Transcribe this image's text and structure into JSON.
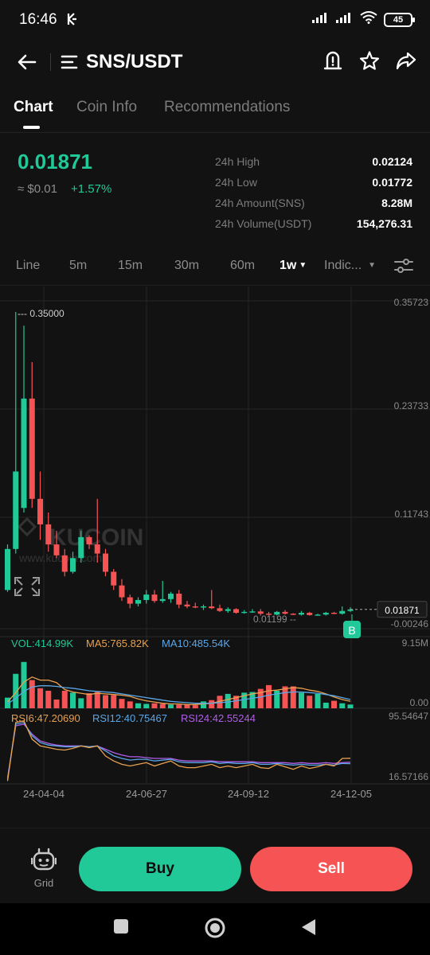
{
  "status": {
    "time": "16:46",
    "battery": "45"
  },
  "header": {
    "pair": "SNS/USDT"
  },
  "tabs": [
    {
      "label": "Chart",
      "active": true
    },
    {
      "label": "Coin Info",
      "active": false
    },
    {
      "label": "Recommendations",
      "active": false
    }
  ],
  "ticker": {
    "price": "0.01871",
    "fiat": "≈ $0.01",
    "change": "+1.57%",
    "stats": [
      {
        "label": "24h High",
        "value": "0.02124"
      },
      {
        "label": "24h Low",
        "value": "0.01772"
      },
      {
        "label": "24h Amount(SNS)",
        "value": "8.28M"
      },
      {
        "label": "24h Volume(USDT)",
        "value": "154,276.31"
      }
    ]
  },
  "toolbar": {
    "intervals": [
      "Line",
      "5m",
      "15m",
      "30m",
      "60m"
    ],
    "selected_interval": "1w",
    "indicators_label": "Indic..."
  },
  "chart_data": [
    {
      "type": "candlestick",
      "interval": "1w",
      "y_ticks": [
        "0.35723",
        "0.23733",
        "0.11743",
        "-0.00246"
      ],
      "ylim": [
        -0.00246,
        0.35723
      ],
      "annotations": {
        "high_marker": "0.35000",
        "low_marker": "0.01199",
        "last_price_tag": "0.01871",
        "trade_marker": "B"
      },
      "x_ticks": [
        "24-04-04",
        "24-06-27",
        "24-09-12",
        "24-12-05"
      ],
      "candles": [
        {
          "o": 0.04,
          "h": 0.09,
          "l": 0.038,
          "c": 0.085
        },
        {
          "o": 0.085,
          "h": 0.345,
          "l": 0.08,
          "c": 0.17
        },
        {
          "o": 0.13,
          "h": 0.33,
          "l": 0.125,
          "c": 0.25
        },
        {
          "o": 0.25,
          "h": 0.29,
          "l": 0.13,
          "c": 0.14
        },
        {
          "o": 0.14,
          "h": 0.17,
          "l": 0.095,
          "c": 0.112
        },
        {
          "o": 0.112,
          "h": 0.125,
          "l": 0.082,
          "c": 0.09
        },
        {
          "o": 0.09,
          "h": 0.105,
          "l": 0.075,
          "c": 0.078
        },
        {
          "o": 0.078,
          "h": 0.085,
          "l": 0.055,
          "c": 0.06
        },
        {
          "o": 0.06,
          "h": 0.082,
          "l": 0.058,
          "c": 0.075
        },
        {
          "o": 0.075,
          "h": 0.105,
          "l": 0.07,
          "c": 0.098
        },
        {
          "o": 0.098,
          "h": 0.1,
          "l": 0.085,
          "c": 0.09
        },
        {
          "o": 0.09,
          "h": 0.14,
          "l": 0.07,
          "c": 0.08
        },
        {
          "o": 0.08,
          "h": 0.085,
          "l": 0.055,
          "c": 0.06
        },
        {
          "o": 0.06,
          "h": 0.063,
          "l": 0.04,
          "c": 0.045
        },
        {
          "o": 0.045,
          "h": 0.052,
          "l": 0.028,
          "c": 0.032
        },
        {
          "o": 0.032,
          "h": 0.035,
          "l": 0.02,
          "c": 0.025
        },
        {
          "o": 0.025,
          "h": 0.032,
          "l": 0.022,
          "c": 0.029
        },
        {
          "o": 0.029,
          "h": 0.04,
          "l": 0.025,
          "c": 0.035
        },
        {
          "o": 0.035,
          "h": 0.04,
          "l": 0.026,
          "c": 0.028
        },
        {
          "o": 0.028,
          "h": 0.05,
          "l": 0.026,
          "c": 0.03
        },
        {
          "o": 0.03,
          "h": 0.038,
          "l": 0.026,
          "c": 0.036
        },
        {
          "o": 0.036,
          "h": 0.04,
          "l": 0.02,
          "c": 0.024
        },
        {
          "o": 0.024,
          "h": 0.028,
          "l": 0.02,
          "c": 0.022
        },
        {
          "o": 0.022,
          "h": 0.026,
          "l": 0.02,
          "c": 0.021
        },
        {
          "o": 0.021,
          "h": 0.024,
          "l": 0.018,
          "c": 0.022
        },
        {
          "o": 0.022,
          "h": 0.04,
          "l": 0.019,
          "c": 0.02
        },
        {
          "o": 0.02,
          "h": 0.024,
          "l": 0.016,
          "c": 0.017
        },
        {
          "o": 0.017,
          "h": 0.021,
          "l": 0.015,
          "c": 0.019
        },
        {
          "o": 0.019,
          "h": 0.02,
          "l": 0.014,
          "c": 0.015
        },
        {
          "o": 0.015,
          "h": 0.018,
          "l": 0.014,
          "c": 0.016
        },
        {
          "o": 0.016,
          "h": 0.019,
          "l": 0.015,
          "c": 0.0165
        },
        {
          "o": 0.0165,
          "h": 0.019,
          "l": 0.012,
          "c": 0.014
        },
        {
          "o": 0.014,
          "h": 0.016,
          "l": 0.012,
          "c": 0.013
        },
        {
          "o": 0.013,
          "h": 0.017,
          "l": 0.012,
          "c": 0.016
        },
        {
          "o": 0.016,
          "h": 0.018,
          "l": 0.013,
          "c": 0.014
        },
        {
          "o": 0.014,
          "h": 0.0145,
          "l": 0.0125,
          "c": 0.013
        },
        {
          "o": 0.013,
          "h": 0.017,
          "l": 0.012,
          "c": 0.015
        },
        {
          "o": 0.015,
          "h": 0.016,
          "l": 0.012,
          "c": 0.0125
        },
        {
          "o": 0.0125,
          "h": 0.014,
          "l": 0.012,
          "c": 0.013
        },
        {
          "o": 0.013,
          "h": 0.016,
          "l": 0.012,
          "c": 0.015
        },
        {
          "o": 0.015,
          "h": 0.016,
          "l": 0.0135,
          "c": 0.014
        },
        {
          "o": 0.014,
          "h": 0.022,
          "l": 0.013,
          "c": 0.017
        },
        {
          "o": 0.017,
          "h": 0.021,
          "l": 0.016,
          "c": 0.0187
        }
      ]
    },
    {
      "type": "bar",
      "name": "volume",
      "labels": {
        "vol": "VOL:414.99K",
        "ma5": "MA5:765.82K",
        "ma10": "MA10:485.54K"
      },
      "y_ticks": [
        "9.15M",
        "0.00"
      ],
      "ylim": [
        0,
        9.15
      ],
      "unit": "M",
      "values": [
        1.7,
        5.5,
        7.4,
        4.5,
        3.2,
        2.8,
        1.4,
        2.8,
        2.5,
        1.6,
        2.4,
        2.6,
        2.1,
        2.1,
        1.5,
        1.1,
        0.8,
        0.7,
        0.8,
        0.7,
        0.6,
        0.6,
        0.6,
        0.5,
        1.1,
        1.3,
        2.0,
        2.3,
        2.0,
        2.5,
        2.6,
        3.1,
        3.7,
        2.8,
        3.5,
        3.5,
        2.5,
        2.0,
        2.3,
        0.9,
        1.2,
        0.8,
        0.6
      ],
      "up": [
        true,
        true,
        true,
        false,
        false,
        false,
        false,
        false,
        true,
        true,
        false,
        false,
        false,
        false,
        false,
        false,
        true,
        true,
        false,
        false,
        true,
        false,
        false,
        false,
        true,
        false,
        false,
        true,
        false,
        true,
        true,
        false,
        false,
        true,
        false,
        false,
        true,
        false,
        true,
        true,
        false,
        true,
        true
      ],
      "ma5": [
        1.0,
        2.5,
        4.2,
        5.0,
        4.5,
        4.5,
        4.1,
        3.0,
        2.6,
        2.4,
        2.2,
        2.4,
        2.3,
        2.2,
        2.1,
        1.9,
        1.5,
        1.2,
        1.0,
        0.8,
        0.7,
        0.7,
        0.6,
        0.6,
        0.7,
        0.8,
        1.1,
        1.4,
        1.7,
        2.0,
        2.3,
        2.5,
        2.8,
        2.9,
        3.1,
        3.3,
        3.2,
        2.9,
        2.7,
        2.3,
        1.8,
        1.4,
        1.1
      ],
      "ma10": [
        0.7,
        1.6,
        2.7,
        3.4,
        3.6,
        3.6,
        3.5,
        3.3,
        3.2,
        3.0,
        2.8,
        2.7,
        2.6,
        2.5,
        2.3,
        2.1,
        1.9,
        1.7,
        1.5,
        1.3,
        1.1,
        1.0,
        0.9,
        0.8,
        0.8,
        0.8,
        0.9,
        1.0,
        1.2,
        1.4,
        1.6,
        1.8,
        2.1,
        2.3,
        2.5,
        2.6,
        2.6,
        2.5,
        2.4,
        2.2,
        2.0,
        1.7,
        1.4
      ]
    },
    {
      "type": "line",
      "name": "RSI",
      "labels": {
        "rsi6": "RSI6:47.20690",
        "rsi12": "RSI12:40.75467",
        "rsi24": "RSI24:42.55244"
      },
      "y_ticks": [
        "95.54647",
        "16.57166"
      ],
      "ylim": [
        16.57166,
        95.54647
      ],
      "rsi6": [
        20,
        90,
        92,
        70,
        62,
        60,
        58,
        57,
        59,
        62,
        60,
        62,
        50,
        44,
        40,
        38,
        40,
        42,
        38,
        41,
        44,
        38,
        36,
        36,
        38,
        40,
        36,
        38,
        36,
        38,
        40,
        36,
        35,
        40,
        37,
        34,
        38,
        35,
        37,
        40,
        38,
        47,
        47.2
      ],
      "rsi12": [
        22,
        88,
        90,
        74,
        66,
        63,
        62,
        61,
        61,
        62,
        61,
        62,
        56,
        50,
        47,
        45,
        46,
        46,
        44,
        45,
        46,
        43,
        42,
        42,
        42,
        43,
        41,
        42,
        41,
        41,
        42,
        40,
        40,
        41,
        40,
        39,
        40,
        39,
        39,
        40,
        39,
        41,
        40.75
      ],
      "rsi24": [
        24,
        86,
        88,
        76,
        68,
        65,
        63,
        62,
        62,
        62,
        61,
        62,
        58,
        54,
        51,
        49,
        49,
        48,
        47,
        47,
        47,
        45,
        44,
        44,
        44,
        44,
        43,
        43,
        43,
        43,
        43,
        42,
        42,
        42,
        42,
        41,
        42,
        41,
        41,
        42,
        41,
        42,
        42.55
      ]
    }
  ],
  "watermark": {
    "brand": "KUCOIN",
    "url": "www.kucoin.com"
  },
  "actions": {
    "grid_label": "Grid",
    "buy_label": "Buy",
    "sell_label": "Sell"
  },
  "colors": {
    "up": "#20c997",
    "down": "#f65454",
    "ma5": "#e8a150",
    "ma10": "#5ba7e8",
    "rsi24": "#b15ee8",
    "background": "#121212"
  }
}
